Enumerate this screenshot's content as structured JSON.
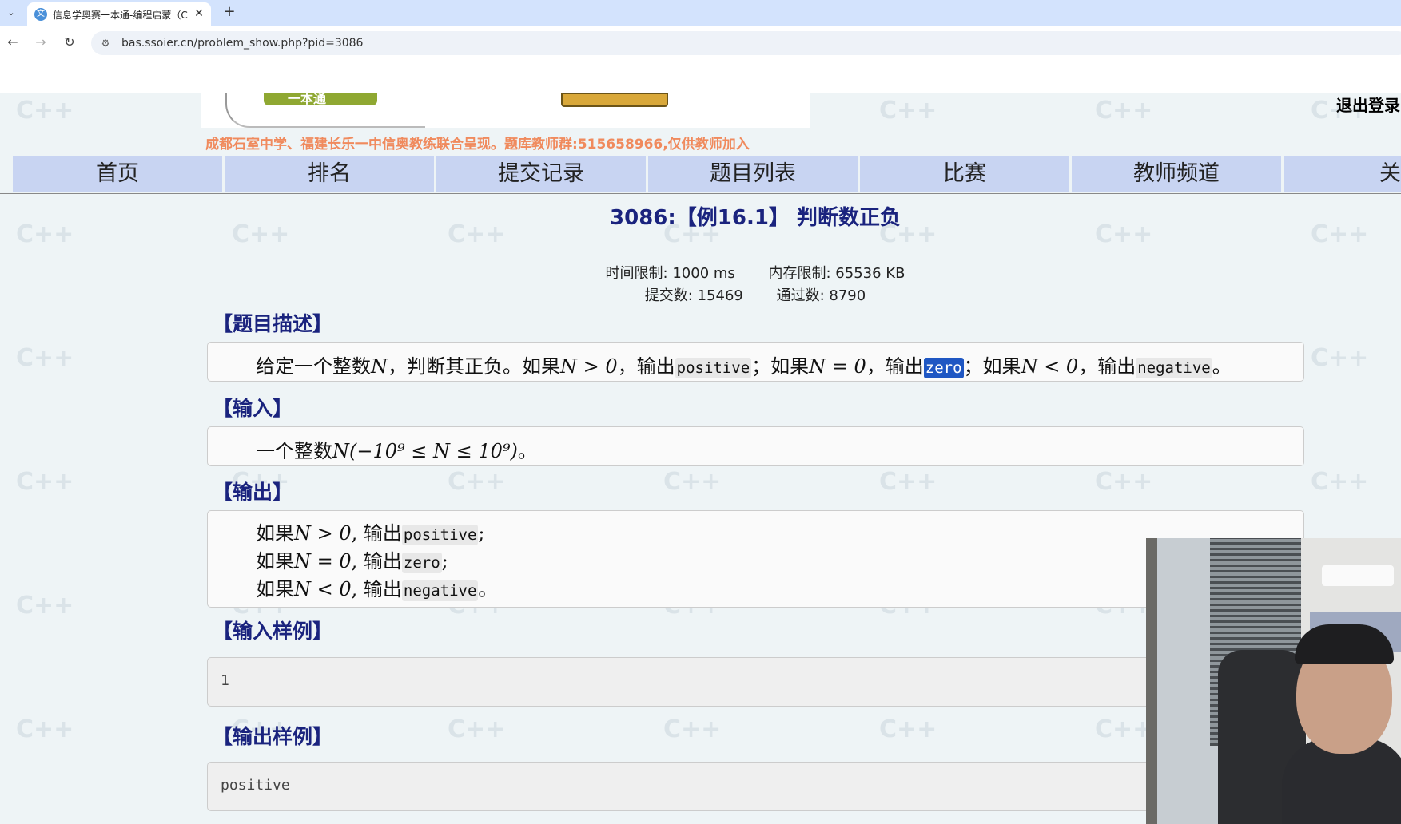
{
  "browser": {
    "tab_title": "信息学奥赛一本通-编程启蒙（C",
    "favicon_glyph": "文",
    "close_glyph": "✕",
    "new_tab_glyph": "+",
    "list_glyph": "⌄",
    "back_glyph": "←",
    "forward_glyph": "→",
    "reload_glyph": "↻",
    "site_info_glyph": "⚙",
    "url": "bas.ssoier.cn/problem_show.php?pid=3086"
  },
  "header": {
    "logo_text": "一本通",
    "subtitle": "成都石室中学、福建长乐一中信奥教练联合呈现。题库教师群:515658966,仅供教师加入",
    "logout": "退出登录"
  },
  "menu": [
    {
      "label": "首页"
    },
    {
      "label": "排名"
    },
    {
      "label": "提交记录"
    },
    {
      "label": "题目列表"
    },
    {
      "label": "比赛"
    },
    {
      "label": "教师频道"
    },
    {
      "label": "关于"
    }
  ],
  "problem": {
    "title": "3086:【例16.1】 判断数正负",
    "time_limit": "时间限制: 1000 ms",
    "memory_limit": "内存限制: 65536 KB",
    "submissions": "提交数: 15469",
    "accepted": "通过数: 8790"
  },
  "sections": {
    "description": {
      "heading": "【题目描述】",
      "t1": "给定一个整数",
      "v1": "N",
      "t2": "，判断其正负。如果",
      "m1": "N > 0",
      "t3": "，输出",
      "c1": "positive",
      "t4": "；如果",
      "m2": "N = 0",
      "t5": "，输出",
      "c2": "zero",
      "t6": "；如果",
      "m3": "N < 0",
      "t7": "，输出",
      "c3": "negative",
      "t8": "。"
    },
    "input": {
      "heading": "【输入】",
      "t1": "一个整数",
      "m1": "N(−10⁹ ≤ N ≤ 10⁹)",
      "t2": "。"
    },
    "output": {
      "heading": "【输出】",
      "lines": [
        {
          "pre": "如果",
          "math": "N > 0",
          "mid": ", 输出",
          "code": "positive",
          "end": ";"
        },
        {
          "pre": "如果",
          "math": "N = 0",
          "mid": ", 输出",
          "code": "zero",
          "end": ";"
        },
        {
          "pre": "如果",
          "math": "N < 0",
          "mid": ", 输出",
          "code": "negative",
          "end": "。"
        }
      ]
    },
    "sample_input": {
      "heading": "【输入样例】",
      "content": "1"
    },
    "sample_output": {
      "heading": "【输出样例】",
      "content": "positive"
    }
  },
  "watermark": {
    "text": "C++"
  }
}
